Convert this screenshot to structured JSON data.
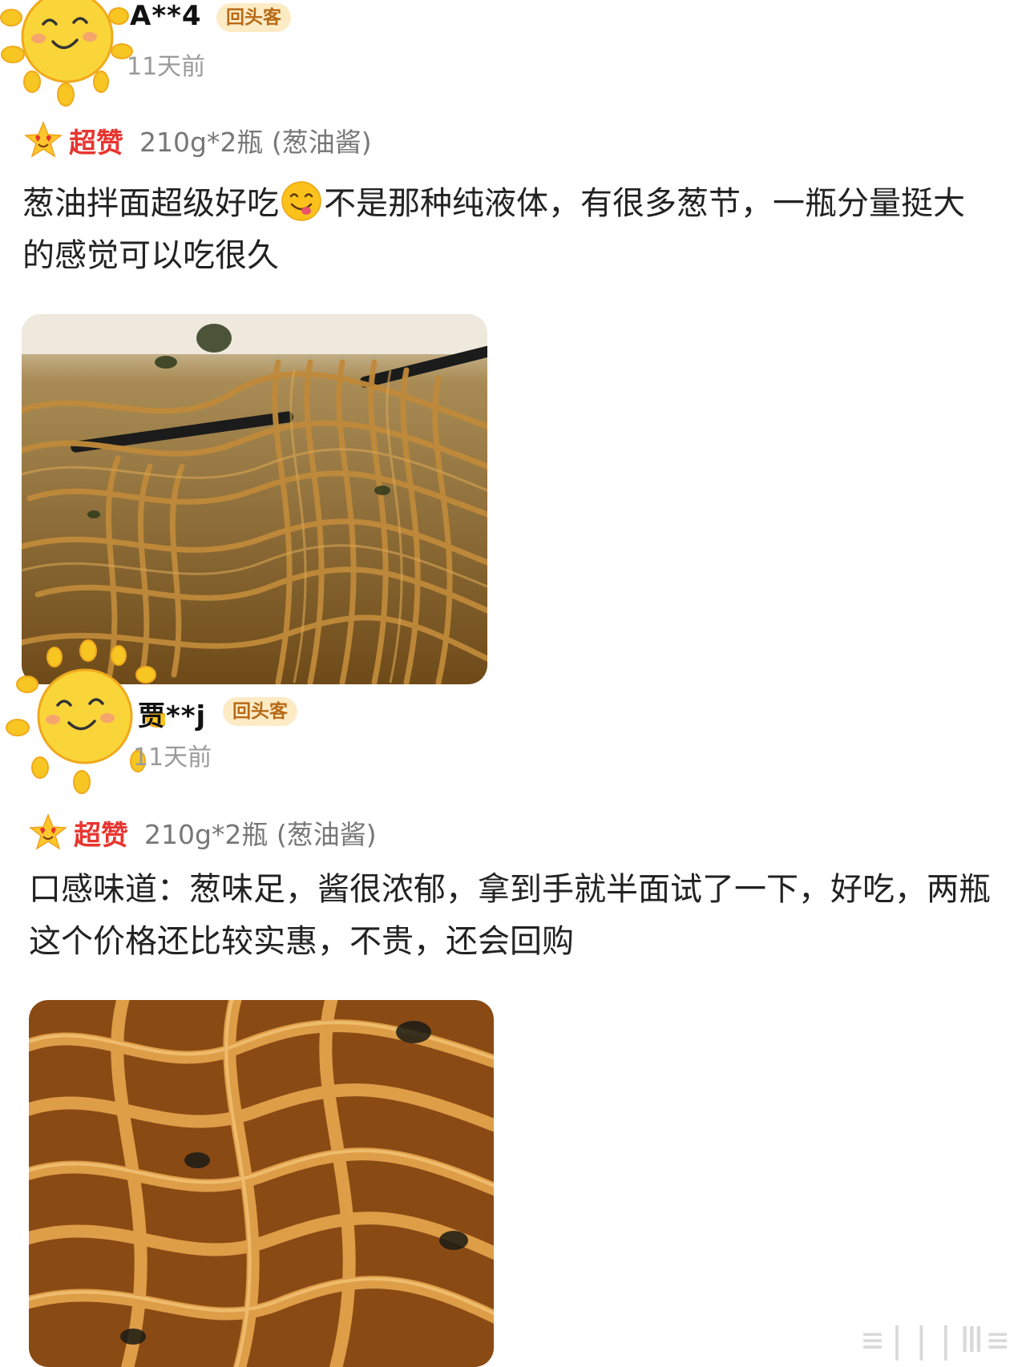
{
  "reviews": [
    {
      "username": "A**4",
      "badge": "回头客",
      "time": "11天前",
      "rating": "超赞",
      "spec": "210g*2瓶 (葱油酱)",
      "text_before_emoji": "葱油拌面超级好吃",
      "text_after_emoji": "不是那种纯液体，有很多葱节，一瓶分量挺大的感觉可以吃很久",
      "emoji": "yum-face-icon"
    },
    {
      "username": "贾**j",
      "badge": "回头客",
      "time": "11天前",
      "rating": "超赞",
      "spec": "210g*2瓶 (葱油酱)",
      "text": "口感味道：葱味足，酱很浓郁，拿到手就半面试了一下，好吃，两瓶这个价格还比较实惠，不贵，还会回购"
    }
  ],
  "colors": {
    "rating": "#e8352f",
    "badge_bg": "#fdebc6",
    "badge_text": "#b86a15",
    "time": "#9a9a9a",
    "sun": "#f7c623"
  }
}
